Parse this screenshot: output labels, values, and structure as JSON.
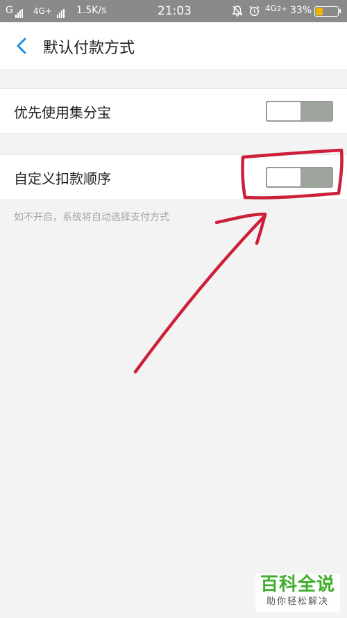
{
  "status_bar": {
    "carrier1": "G",
    "net2": "4G+",
    "speed": "1.5K/s",
    "time": "21:03",
    "net_right": "4G",
    "net_right_sub": "2+",
    "battery": "33%",
    "battery_level": 0.33,
    "alarm_icon": "alarm-icon",
    "mute_icon": "bell-off-icon"
  },
  "header": {
    "title": "默认付款方式",
    "back_icon": "chevron-left-icon",
    "accent_color": "#1e8ee0"
  },
  "settings": [
    {
      "label": "优先使用集分宝",
      "enabled": false
    },
    {
      "label": "自定义扣款顺序",
      "enabled": false
    }
  ],
  "hint": "如不开启，系统将自动选择支付方式",
  "annotation_color": "#cc1f3a",
  "watermark": {
    "title": "百科全说",
    "subtitle": "助你轻松解决",
    "color": "#3fae2a"
  }
}
